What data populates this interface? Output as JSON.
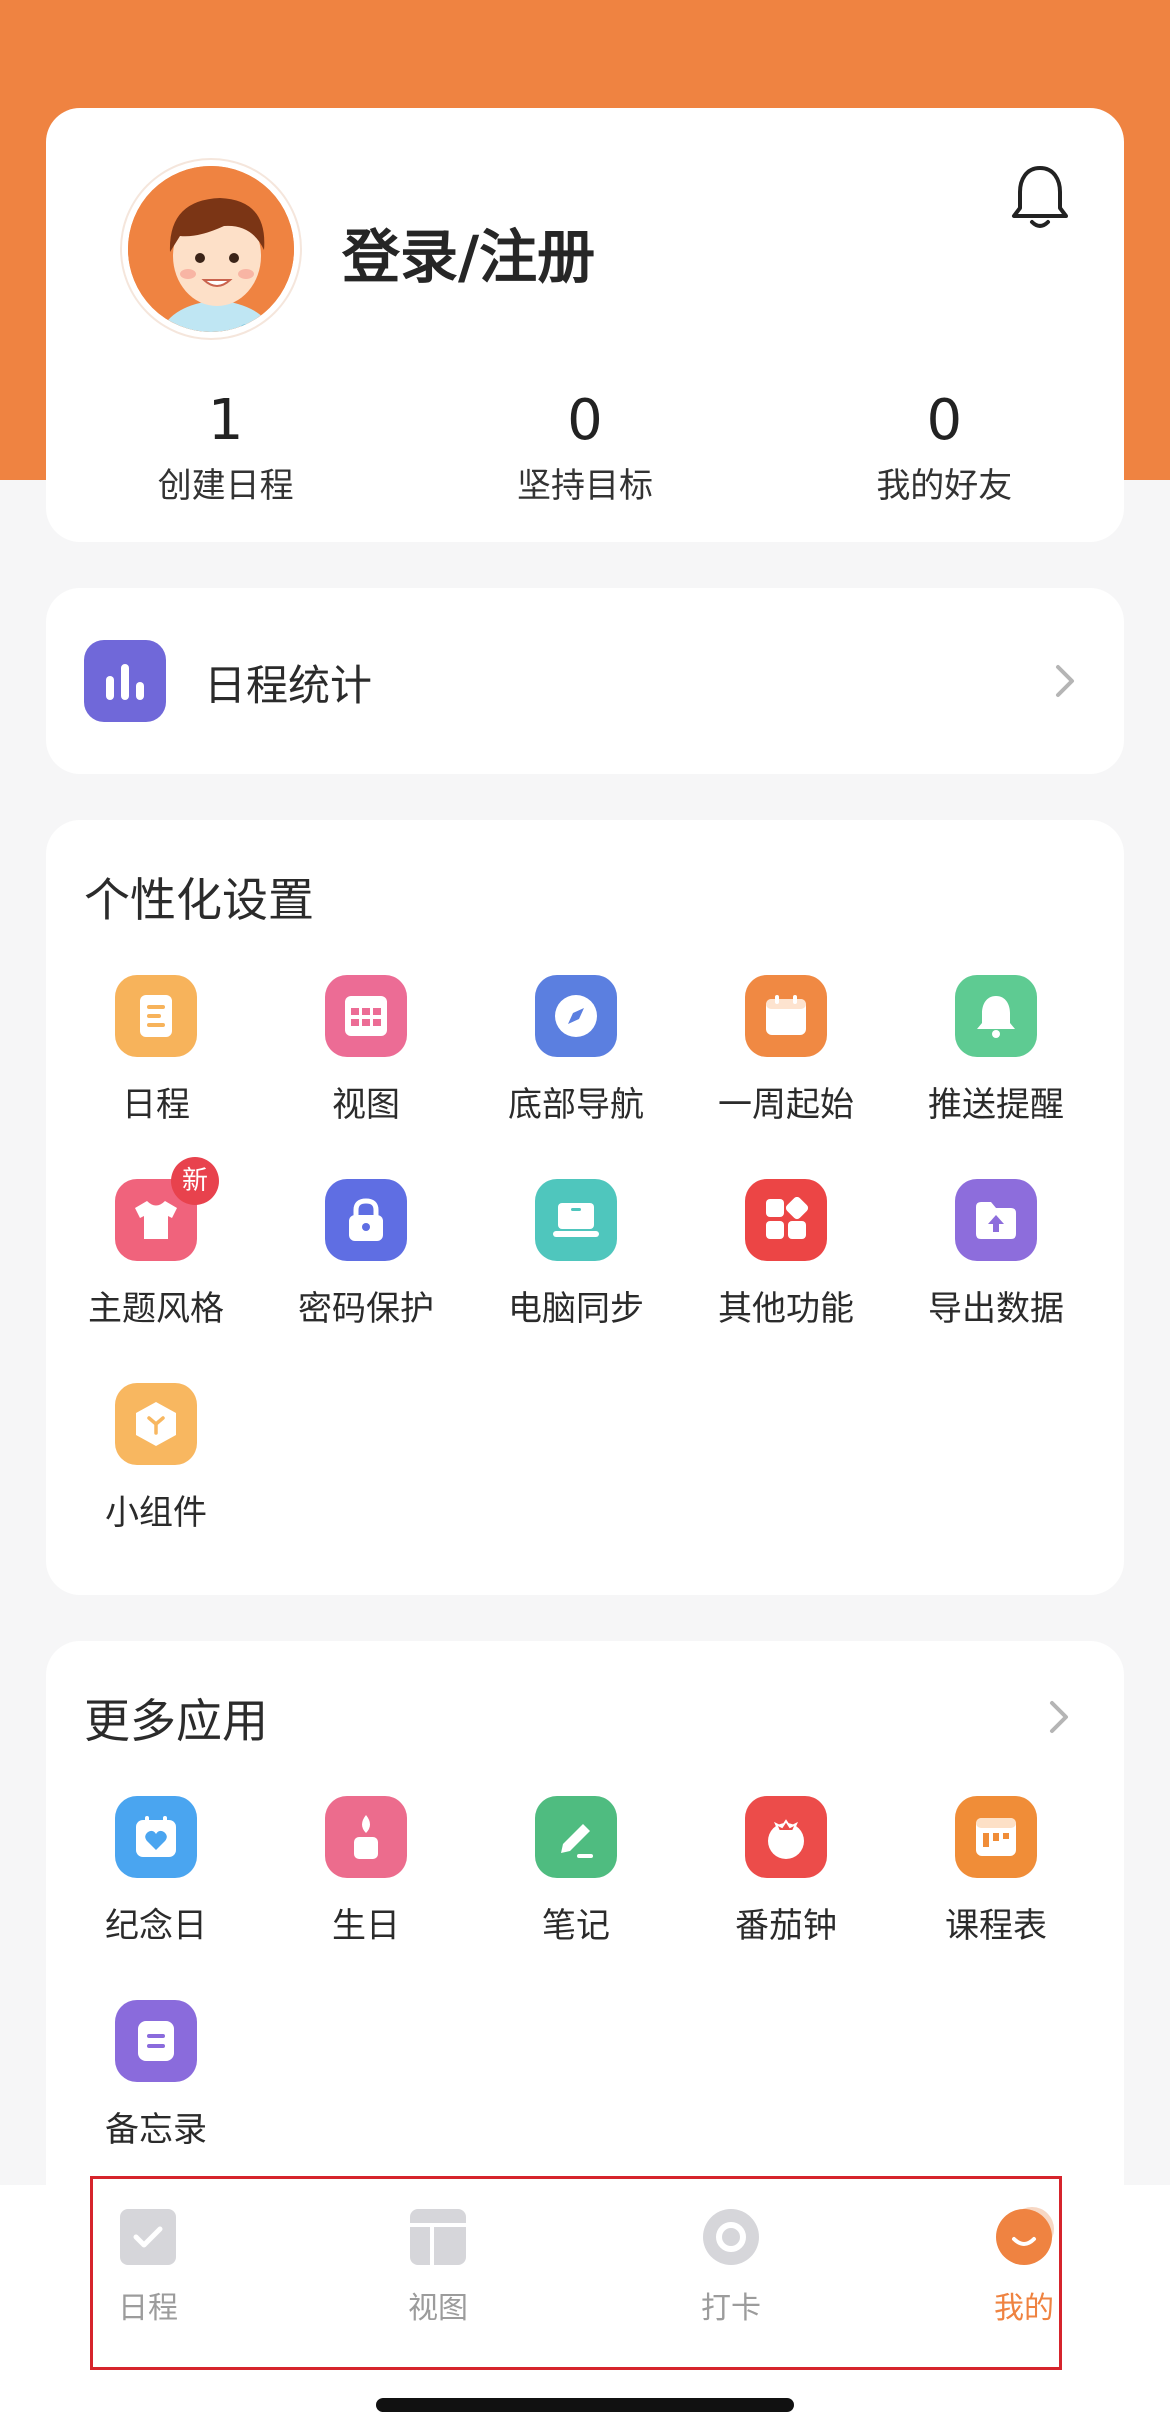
{
  "profile": {
    "login_label": "登录/注册",
    "stats": [
      {
        "value": "1",
        "label": "创建日程"
      },
      {
        "value": "0",
        "label": "坚持目标"
      },
      {
        "value": "0",
        "label": "我的好友"
      }
    ]
  },
  "schedule_stats": {
    "label": "日程统计"
  },
  "personalization": {
    "title": "个性化设置",
    "items": [
      {
        "label": "日程",
        "icon": "schedule-icon",
        "color": "#f7b35b"
      },
      {
        "label": "视图",
        "icon": "view-grid-icon",
        "color": "#ec6c95"
      },
      {
        "label": "底部导航",
        "icon": "compass-icon",
        "color": "#5b7fe0"
      },
      {
        "label": "一周起始",
        "icon": "calendar-icon",
        "color": "#f08943"
      },
      {
        "label": "推送提醒",
        "icon": "bell-icon",
        "color": "#5ecb92"
      },
      {
        "label": "主题风格",
        "icon": "tshirt-icon",
        "color": "#f0637c",
        "badge": "新"
      },
      {
        "label": "密码保护",
        "icon": "lock-icon",
        "color": "#5f6ee3"
      },
      {
        "label": "电脑同步",
        "icon": "laptop-icon",
        "color": "#4fc6bd"
      },
      {
        "label": "其他功能",
        "icon": "apps-icon",
        "color": "#ec4545"
      },
      {
        "label": "导出数据",
        "icon": "folder-upload-icon",
        "color": "#8d6ddc"
      },
      {
        "label": "小组件",
        "icon": "widget-icon",
        "color": "#f8b760"
      }
    ]
  },
  "more_apps": {
    "title": "更多应用",
    "items": [
      {
        "label": "纪念日",
        "icon": "anniversary-icon",
        "color": "#4aa5f0"
      },
      {
        "label": "生日",
        "icon": "birthday-candle-icon",
        "color": "#ec6c8d"
      },
      {
        "label": "笔记",
        "icon": "pencil-icon",
        "color": "#4fbc80"
      },
      {
        "label": "番茄钟",
        "icon": "tomato-icon",
        "color": "#ec4c4a"
      },
      {
        "label": "课程表",
        "icon": "timetable-icon",
        "color": "#f08d38"
      },
      {
        "label": "备忘录",
        "icon": "memo-icon",
        "color": "#8a6bdc"
      }
    ]
  },
  "tabbar": {
    "tabs": [
      {
        "label": "日程",
        "active": false
      },
      {
        "label": "视图",
        "active": false
      },
      {
        "label": "打卡",
        "active": false
      },
      {
        "label": "我的",
        "active": true
      }
    ]
  },
  "colors": {
    "accent": "#ef8341",
    "highlight_box": "#d6242c"
  }
}
